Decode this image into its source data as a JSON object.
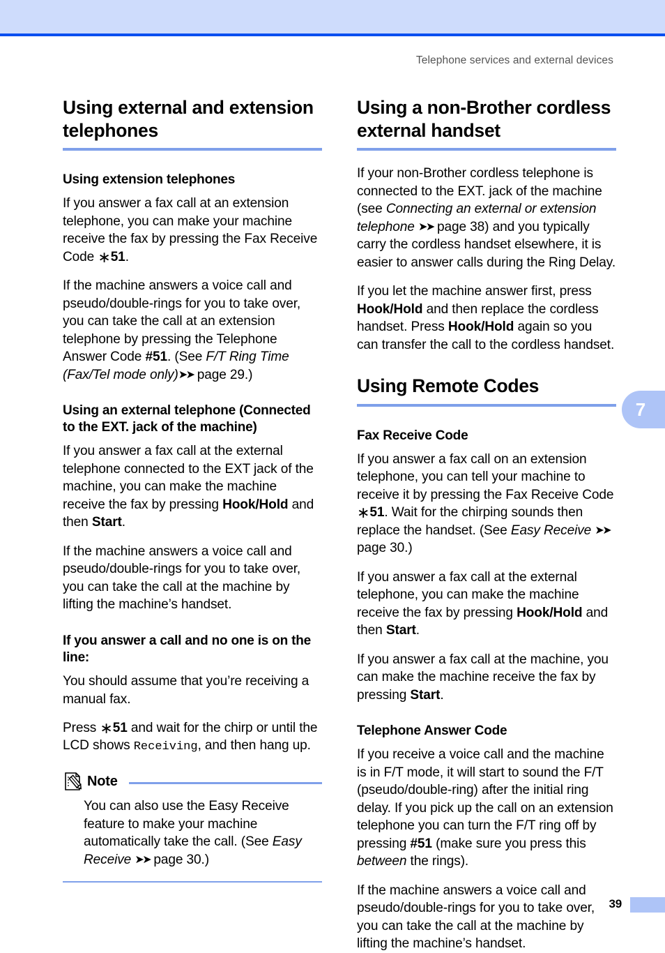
{
  "page": {
    "running_head": "Telephone services and external devices",
    "folio": "39",
    "chapter_tab": "7",
    "colors": {
      "band": "#cedcfc",
      "band_rule": "#0a4ff0",
      "heading_rule": "#7fa0ea",
      "tab": "#aec4f7",
      "running_head_text": "#555555"
    }
  },
  "left_column": {
    "heading": "Using external and extension telephones",
    "sub1": {
      "title": "Using extension telephones",
      "p1_a": "If you answer a fax call at an extension telephone, you can make your machine receive the fax by pressing the Fax Receive Code ",
      "p1_ast": "∗",
      "p1_code": "51",
      "p1_b": ".",
      "p2_a": "If the machine answers a voice call and pseudo/double-rings for you to take over, you can take the call at an extension telephone by pressing the Telephone Answer Code ",
      "p2_code": "#51",
      "p2_b": ". (See ",
      "p2_italic": "F/T Ring Time (Fax/Tel mode only)",
      "p2_arrows": "➤➤",
      "p2_c": " page 29.)"
    },
    "sub2": {
      "title": "Using an external telephone (Connected to the EXT. jack of the machine)",
      "p1_a": "If you answer a fax call at the external telephone connected to the EXT jack of the machine, you can make the machine receive the fax by pressing ",
      "p1_b1": "Hook/Hold",
      "p1_c": " and then ",
      "p1_b2": "Start",
      "p1_d": ".",
      "p2": "If the machine answers a voice call and pseudo/double-rings for you to take over, you can take the call at the machine by lifting the machine’s handset."
    },
    "sub3": {
      "title": "If you answer a call and no one is on the line:",
      "p1": "You should assume that you’re receiving a manual fax.",
      "p2_a": "Press ",
      "p2_ast": "∗",
      "p2_code": "51",
      "p2_b": " and wait for the chirp or until the LCD shows ",
      "p2_mono": "Receiving",
      "p2_c": ", and then hang up."
    },
    "note": {
      "icon": "note-pencil-icon",
      "label": "Note",
      "text_a": "You can also use the Easy Receive feature to make your machine automatically take the call. (See ",
      "text_italic": "Easy Receive",
      "arrows": "➤➤",
      "text_b": " page 30.)"
    }
  },
  "right_column": {
    "heading1": "Using a non-Brother cordless external handset",
    "h1_p1_a": "If your non-Brother cordless telephone is connected to the EXT. jack of the machine (see ",
    "h1_p1_italic": "Connecting an external or extension telephone",
    "h1_p1_arrows": "➤➤",
    "h1_p1_b": " page 38) and you typically carry the cordless handset elsewhere, it is easier to answer calls during the Ring Delay.",
    "h1_p2_a": "If you let the machine answer first, press ",
    "h1_p2_b1": "Hook/Hold",
    "h1_p2_c": " and then replace the cordless handset. Press ",
    "h1_p2_b2": "Hook/Hold",
    "h1_p2_d": " again so you can transfer the call to the cordless handset.",
    "heading2": "Using Remote Codes",
    "sub1": {
      "title": "Fax Receive Code",
      "p1_a": "If you answer a fax call on an extension telephone, you can tell your machine to receive it by pressing the Fax Receive Code ",
      "p1_ast": "∗",
      "p1_code": "51",
      "p1_b": ". Wait for the chirping sounds then replace the handset. (See ",
      "p1_italic": "Easy Receive",
      "p1_arrows": "➤➤",
      "p1_c": " page 30.)",
      "p2_a": "If you answer a fax call at the external telephone, you can make the machine receive the fax by pressing ",
      "p2_b1": "Hook/Hold",
      "p2_c": " and then ",
      "p2_b2": "Start",
      "p2_d": ".",
      "p3_a": "If you answer a fax call at the machine, you can make the machine receive the fax by pressing ",
      "p3_b": "Start",
      "p3_c": "."
    },
    "sub2": {
      "title": "Telephone Answer Code",
      "p1_a": "If you receive a voice call and the machine is in F/T mode, it will start to sound the F/T (pseudo/double-ring) after the initial ring delay. If you pick up the call on an extension telephone you can turn the F/T ring off by pressing ",
      "p1_code": "#51",
      "p1_b": " (make sure you press this ",
      "p1_italic": "between",
      "p1_c": " the rings).",
      "p2": "If the machine answers a voice call and pseudo/double-rings for you to take over, you can take the call at the machine by lifting the machine’s handset."
    }
  }
}
